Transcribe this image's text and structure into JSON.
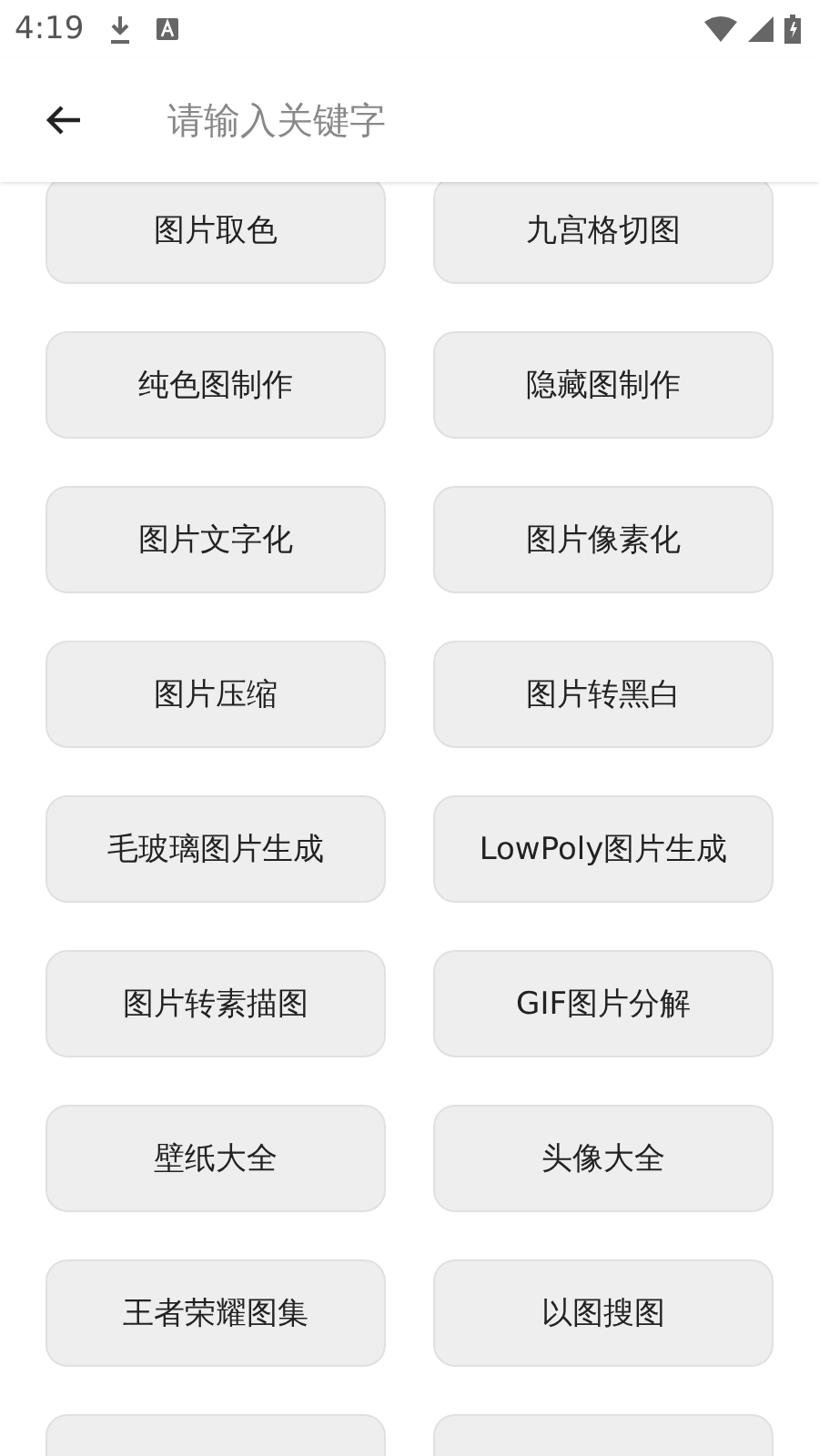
{
  "status_bar": {
    "time": "4:19"
  },
  "search": {
    "placeholder": "请输入关键字"
  },
  "tools": [
    {
      "kind": "button",
      "label": "图片取色"
    },
    {
      "kind": "button",
      "label": "九宫格切图"
    },
    {
      "kind": "button",
      "label": "纯色图制作"
    },
    {
      "kind": "button",
      "label": "隐藏图制作"
    },
    {
      "kind": "button",
      "label": "图片文字化"
    },
    {
      "kind": "button",
      "label": "图片像素化"
    },
    {
      "kind": "button",
      "label": "图片压缩"
    },
    {
      "kind": "button",
      "label": "图片转黑白"
    },
    {
      "kind": "button",
      "label": "毛玻璃图片生成"
    },
    {
      "kind": "button",
      "label": "LowPoly图片生成"
    },
    {
      "kind": "button",
      "label": "图片转素描图"
    },
    {
      "kind": "button",
      "label": "GIF图片分解"
    },
    {
      "kind": "button",
      "label": "壁纸大全"
    },
    {
      "kind": "button",
      "label": "头像大全"
    },
    {
      "kind": "button",
      "label": "王者荣耀图集"
    },
    {
      "kind": "button",
      "label": "以图搜图"
    },
    {
      "kind": "cut-off"
    },
    {
      "kind": "cut-off"
    }
  ]
}
